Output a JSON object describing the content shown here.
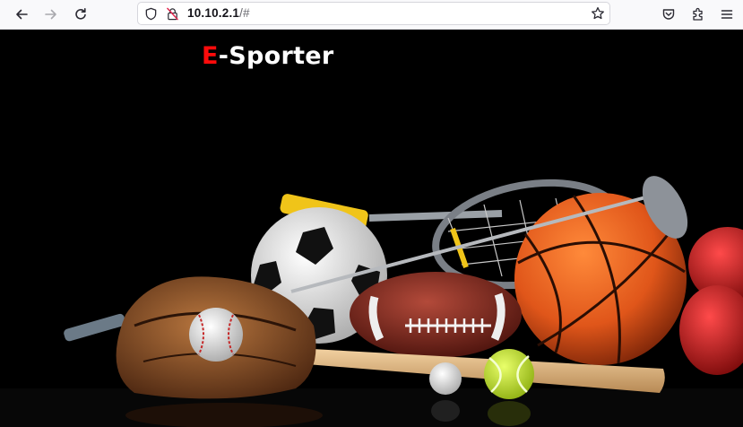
{
  "browser": {
    "url_host": "10.10.2.1",
    "url_path": "/#",
    "icons": [
      "back-icon",
      "forward-icon",
      "reload-icon",
      "shield-icon",
      "insecure-lock-icon",
      "bookmark-star-icon",
      "pocket-icon",
      "extensions-icon",
      "menu-icon"
    ]
  },
  "site": {
    "logo_accent": "E",
    "logo_rest": "-Sporter",
    "accent_color": "#ff0b0b"
  }
}
